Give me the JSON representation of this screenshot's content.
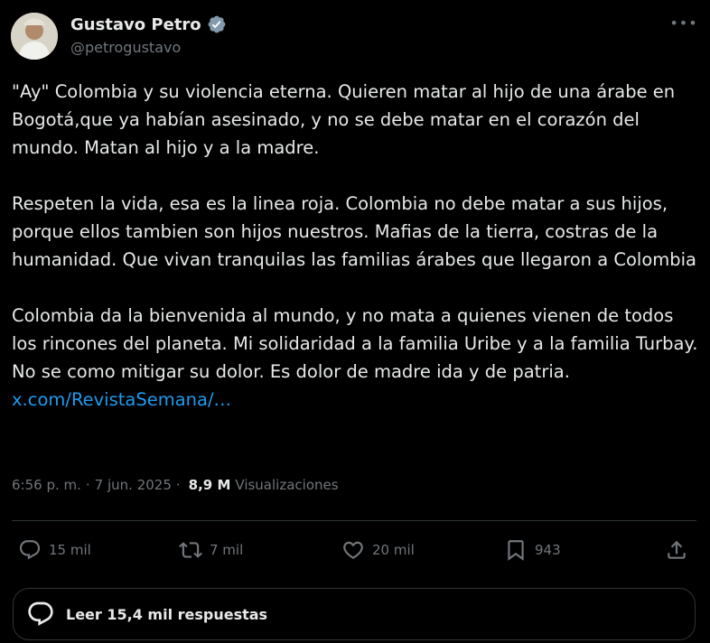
{
  "author": {
    "display_name": "Gustavo Petro",
    "handle": "@petrogustavo",
    "verified": true
  },
  "tweet": {
    "paragraphs": [
      "\"Ay\" Colombia y su violencia eterna. Quieren matar al hijo de una árabe en Bogotá,que ya habían asesinado, y no se debe matar en el corazón del mundo. Matan al hijo y a la madre.",
      "Respeten la vida, esa es la linea roja. Colombia no debe matar a sus hijos, porque ellos tambien son hijos nuestros. Mafias de la tierra, costras de la humanidad. Que vivan tranquilas las familias árabes que llegaron a Colombia",
      "Colombia da la bienvenida al mundo, y no mata a quienes vienen de todos los rincones del planeta. Mi solidaridad a la familia Uribe y a la familia Turbay. No se como mitigar su dolor. Es dolor de madre ida y de patria."
    ],
    "link_text": "x.com/RevistaSemana/…",
    "time": "6:56 p. m.",
    "separator": "·",
    "date": "7 jun. 2025",
    "views_count": "8,9 M",
    "views_label": "Visualizaciones"
  },
  "actions": {
    "replies": "15 mil",
    "reposts": "7 mil",
    "likes": "20 mil",
    "bookmarks": "943"
  },
  "read_replies_label": "Leer 15,4 mil respuestas",
  "colors": {
    "background": "#000000",
    "text": "#e7e9ea",
    "muted": "#71767b",
    "link": "#1d9bf0",
    "border": "#2f3336",
    "verified_badge": "#829aab"
  },
  "icons": [
    "verified-badge-icon",
    "more-icon",
    "reply-icon",
    "repost-icon",
    "like-icon",
    "bookmark-icon",
    "share-icon",
    "chat-bubble-icon"
  ]
}
